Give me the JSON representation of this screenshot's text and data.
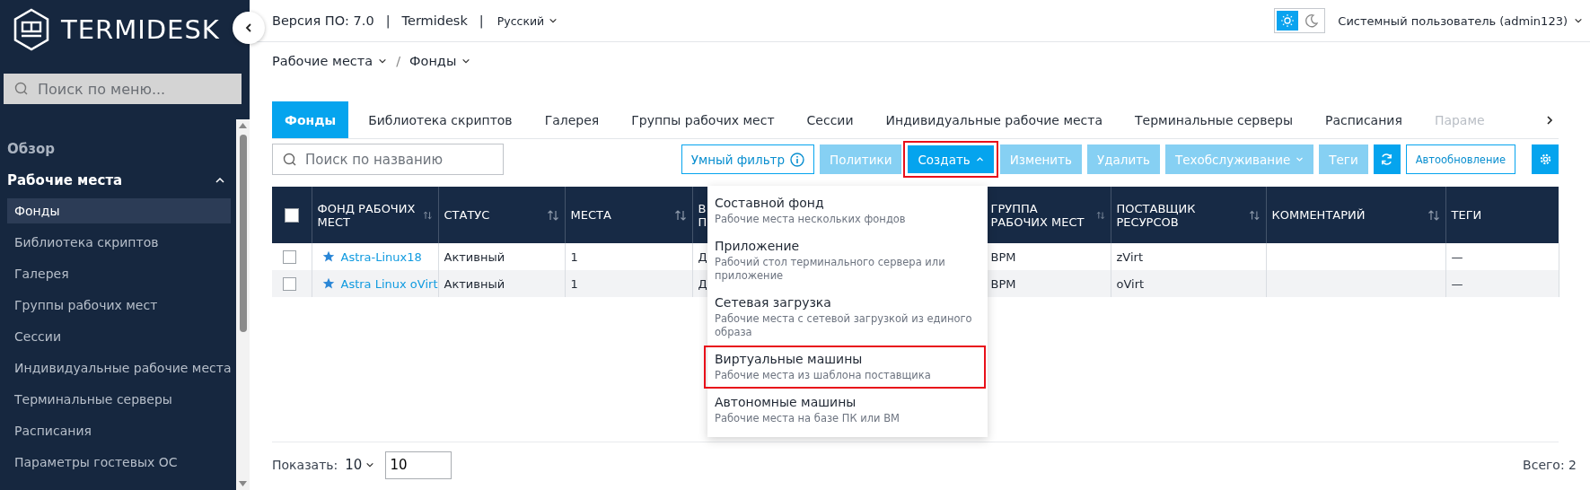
{
  "sidebar": {
    "brand": "TERMIDESK",
    "search_placeholder": "Поиск по меню...",
    "sections": [
      {
        "label": "Обзор"
      },
      {
        "label": "Рабочие места",
        "expanded": true,
        "children": [
          {
            "label": "Фонды",
            "selected": true
          },
          {
            "label": "Библиотека скриптов",
            "selected": false
          },
          {
            "label": "Галерея",
            "selected": false
          },
          {
            "label": "Группы рабочих мест",
            "selected": false
          },
          {
            "label": "Сессии",
            "selected": false
          },
          {
            "label": "Индивидуальные рабочие места",
            "selected": false
          },
          {
            "label": "Терминальные серверы",
            "selected": false
          },
          {
            "label": "Расписания",
            "selected": false
          },
          {
            "label": "Параметры гостевых ОС",
            "selected": false
          }
        ]
      }
    ]
  },
  "topbar": {
    "version": "Версия ПО: 7.0",
    "separators": [
      "|",
      "|"
    ],
    "product": "Termidesk",
    "language": "Русский",
    "theme": [
      {
        "kind": "light",
        "selected": true
      },
      {
        "kind": "dark",
        "selected": false
      }
    ],
    "user": "Системный пользователь (admin123)"
  },
  "breadcrumb": {
    "items": [
      "Рабочие места",
      "Фонды"
    ],
    "separator": "/"
  },
  "tabs": [
    {
      "label": "Фонды",
      "selected": true
    },
    {
      "label": "Библиотека скриптов",
      "selected": false
    },
    {
      "label": "Галерея",
      "selected": false
    },
    {
      "label": "Группы рабочих мест",
      "selected": false
    },
    {
      "label": "Сессии",
      "selected": false
    },
    {
      "label": "Индивидуальные рабочие места",
      "selected": false
    },
    {
      "label": "Терминальные серверы",
      "selected": false
    },
    {
      "label": "Расписания",
      "selected": false
    },
    {
      "label": "Параме",
      "selected": false
    }
  ],
  "toolbar": {
    "search_placeholder": "Поиск по названию",
    "buttons": [
      {
        "kind": "filter",
        "label": "Умный фильтр",
        "disabled": false
      },
      {
        "kind": "plain",
        "label": "Политики",
        "disabled": true
      },
      {
        "kind": "menu",
        "label": "Создать",
        "disabled": false,
        "expanded": true,
        "highlighted": true
      },
      {
        "kind": "plain",
        "label": "Изменить",
        "disabled": true
      },
      {
        "kind": "plain",
        "label": "Удалить",
        "disabled": true
      },
      {
        "kind": "menu",
        "label": "Техобслуживание",
        "disabled": true,
        "expanded": false,
        "highlighted": false
      },
      {
        "kind": "plain",
        "label": "Теги",
        "disabled": true
      },
      {
        "kind": "refresh",
        "disabled": false
      },
      {
        "kind": "toggle",
        "label": "Автообновление",
        "disabled": false
      },
      {
        "kind": "settings",
        "disabled": false
      }
    ]
  },
  "create_menu": [
    {
      "title": "Составной фонд",
      "description": "Рабочие места нескольких фондов",
      "highlighted": false
    },
    {
      "title": "Приложение",
      "description": "Рабочий стол терминального сервера или приложение",
      "highlighted": false
    },
    {
      "title": "Сетевая загрузка",
      "description": "Рабочие места с сетевой загрузкой из единого образа",
      "highlighted": false
    },
    {
      "title": "Виртуальные машины",
      "description": "Рабочие места из шаблона поставщика",
      "highlighted": true
    },
    {
      "title": "Автономные машины",
      "description": "Рабочие места на базе ПК или ВМ",
      "highlighted": false
    }
  ],
  "table": {
    "select_all": {
      "checked": false
    },
    "columns": [
      {
        "label": "ФОНД РАБОЧИХ МЕСТ",
        "sortable": true
      },
      {
        "label": "СТАТУС",
        "sortable": true
      },
      {
        "label": "МЕСТА",
        "sortable": true
      },
      {
        "label": "В\nП"
      },
      {
        "label": "ГРУППА РАБОЧИХ МЕСТ",
        "sortable": true
      },
      {
        "label": "ПОСТАВЩИК РЕСУРСОВ",
        "sortable": true
      },
      {
        "label": "КОММЕНТАРИЙ",
        "sortable": true
      },
      {
        "label": "ТЕГИ",
        "sortable": false
      }
    ],
    "rows": [
      {
        "checked": false,
        "cells": [
          "Astra-Linux18",
          "Активный",
          "1",
          "Д",
          "ВРМ",
          "zVirt",
          null,
          "—"
        ]
      },
      {
        "checked": false,
        "cells": [
          "Astra Linux oVirt",
          "Активный",
          "1",
          "Д",
          "ВРМ",
          "oVirt",
          null,
          "—"
        ]
      }
    ]
  },
  "pagination": {
    "label": "Показать:",
    "page_size": "10",
    "page_input": "10",
    "total": "Всего: 2"
  }
}
